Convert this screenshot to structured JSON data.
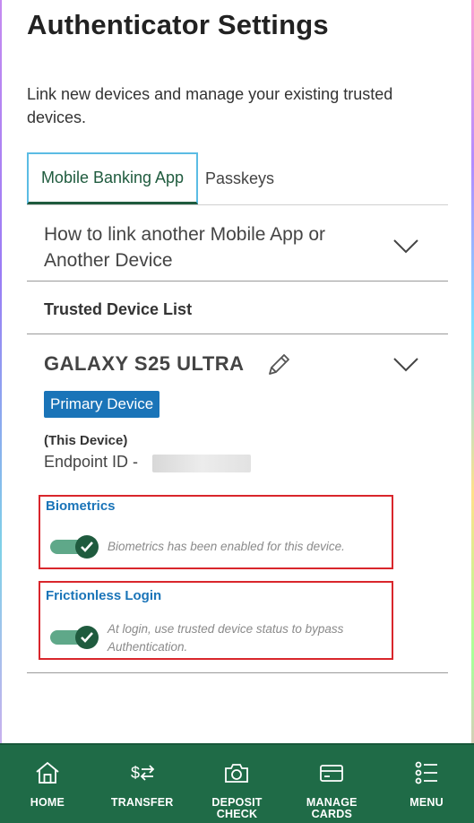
{
  "page": {
    "title": "Authenticator Settings",
    "subtitle": "Link new devices and manage your existing trusted devices."
  },
  "tabs": [
    {
      "label": "Mobile Banking App",
      "active": true
    },
    {
      "label": "Passkeys",
      "active": false
    }
  ],
  "howto": {
    "label": "How to link another Mobile App or Another Device",
    "icon": "chevron-down-icon"
  },
  "trusted": {
    "title": "Trusted Device List"
  },
  "device": {
    "name": "GALAXY S25 ULTRA",
    "badge": "Primary Device",
    "this_device": "(This Device)",
    "endpoint_label": "Endpoint ID -",
    "edit_icon": "pencil-icon"
  },
  "settings": {
    "biometrics": {
      "title": "Biometrics",
      "description": "Biometrics has been enabled for this device.",
      "enabled": true
    },
    "frictionless": {
      "title": "Frictionless Login",
      "description_line1": "At login, use trusted device status to bypass",
      "description_line2": "Authentication.",
      "enabled": true
    }
  },
  "nav": [
    {
      "icon": "home-icon",
      "line1": "HOME",
      "line2": ""
    },
    {
      "icon": "transfer-icon",
      "line1": "TRANSFER",
      "line2": ""
    },
    {
      "icon": "camera-icon",
      "line1": "DEPOSIT",
      "line2": "CHECK"
    },
    {
      "icon": "card-icon",
      "line1": "MANAGE",
      "line2": "CARDS"
    },
    {
      "icon": "menu-icon",
      "line1": "MENU",
      "line2": ""
    }
  ],
  "colors": {
    "brand_green": "#1f6b47",
    "accent_blue": "#1a74b8",
    "highlight_red": "#d9262c"
  }
}
